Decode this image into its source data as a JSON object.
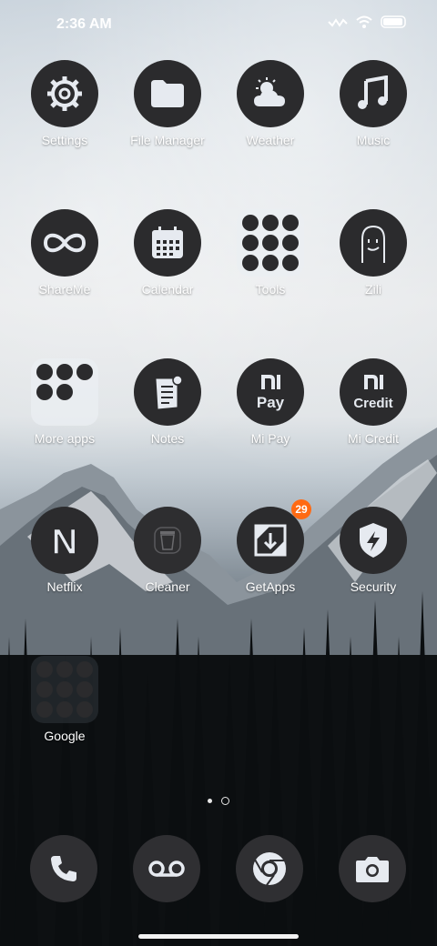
{
  "status_bar": {
    "time": "2:36 AM"
  },
  "apps": [
    {
      "label": "Settings",
      "icon": "gear-icon"
    },
    {
      "label": "File Manager",
      "icon": "folder-icon"
    },
    {
      "label": "Weather",
      "icon": "weather-icon"
    },
    {
      "label": "Music",
      "icon": "music-note-icon"
    },
    {
      "label": "ShareMe",
      "icon": "infinity-icon"
    },
    {
      "label": "Calendar",
      "icon": "calendar-icon"
    },
    {
      "label": "Tools",
      "icon": "tools-folder-icon"
    },
    {
      "label": "Zili",
      "icon": "zili-face-icon"
    },
    {
      "label": "More apps",
      "icon": "more-apps-folder-icon"
    },
    {
      "label": "Notes",
      "icon": "notes-icon"
    },
    {
      "label": "Mi Pay",
      "icon": "mi-pay-icon",
      "icon_text": "Pay"
    },
    {
      "label": "Mi Credit",
      "icon": "mi-credit-icon",
      "icon_text": "Credit"
    },
    {
      "label": "Netflix",
      "icon": "netflix-icon",
      "icon_text": "N"
    },
    {
      "label": "Cleaner",
      "icon": "trash-icon"
    },
    {
      "label": "GetApps",
      "icon": "getapps-icon",
      "badge": "29"
    },
    {
      "label": "Security",
      "icon": "shield-bolt-icon"
    },
    {
      "label": "Google",
      "icon": "google-folder-icon"
    }
  ],
  "dock": [
    {
      "name": "phone",
      "icon": "phone-icon"
    },
    {
      "name": "voicemail",
      "icon": "voicemail-icon"
    },
    {
      "name": "chrome",
      "icon": "chrome-icon"
    },
    {
      "name": "camera",
      "icon": "camera-icon"
    }
  ],
  "page_indicator": {
    "current": 1,
    "total": 2
  },
  "colors": {
    "icon_bg": "#2b2b2d",
    "badge": "#ff6a13",
    "label": "#ffffff"
  }
}
